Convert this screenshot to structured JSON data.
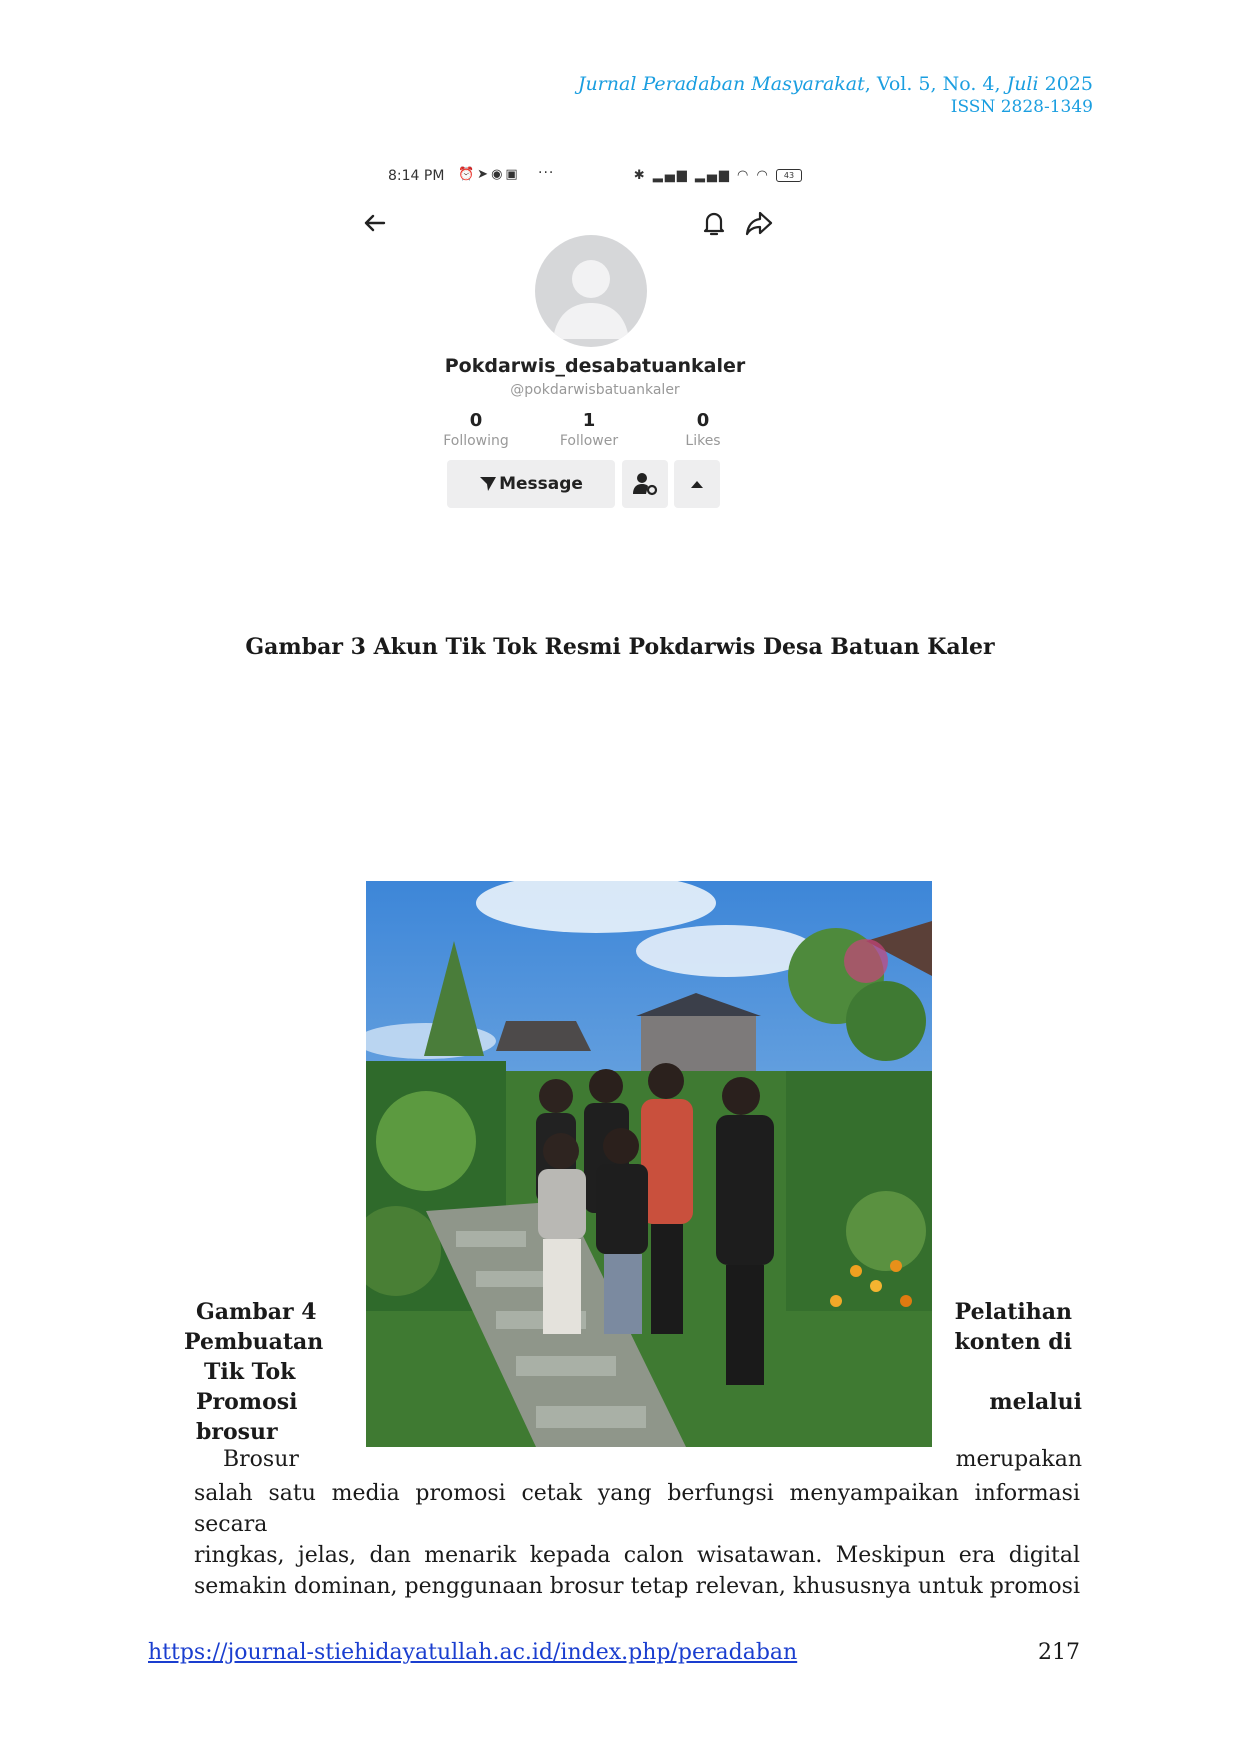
{
  "header": {
    "journal": "Jurnal Peradaban Masyarakat",
    "volume": ", Vol. 5, No. 4, ",
    "month": "Juli",
    "year": " 2025",
    "issn": "ISSN 2828-1349"
  },
  "phone": {
    "time": "8:14 PM",
    "battery": "43",
    "username": "Pokdarwis_desabatuankaler",
    "handle": "@pokdarwisbatuankaler",
    "stats": [
      {
        "num": "0",
        "label": "Following"
      },
      {
        "num": "1",
        "label": "Follower"
      },
      {
        "num": "0",
        "label": "Likes"
      }
    ],
    "message_label": "Message"
  },
  "caption3": "Gambar 3 Akun Tik Tok Resmi Pokdarwis Desa Batuan Kaler",
  "caption4": {
    "left": [
      "Gambar 4",
      "Pembuatan",
      "Tik Tok",
      "Promosi",
      "brosur"
    ],
    "right": [
      "Pelatihan",
      "konten di",
      "melalui"
    ]
  },
  "paragraph": {
    "first_left": "Brosur",
    "first_right": "merupakan",
    "lines": [
      "salah satu media promosi cetak yang berfungsi menyampaikan informasi secara",
      "ringkas, jelas, dan menarik kepada calon wisatawan. Meskipun era digital",
      "semakin dominan, penggunaan brosur tetap relevan, khususnya untuk promosi"
    ]
  },
  "footer": {
    "url": "https://journal-stiehidayatullah.ac.id/index.php/peradaban",
    "page": "217"
  }
}
